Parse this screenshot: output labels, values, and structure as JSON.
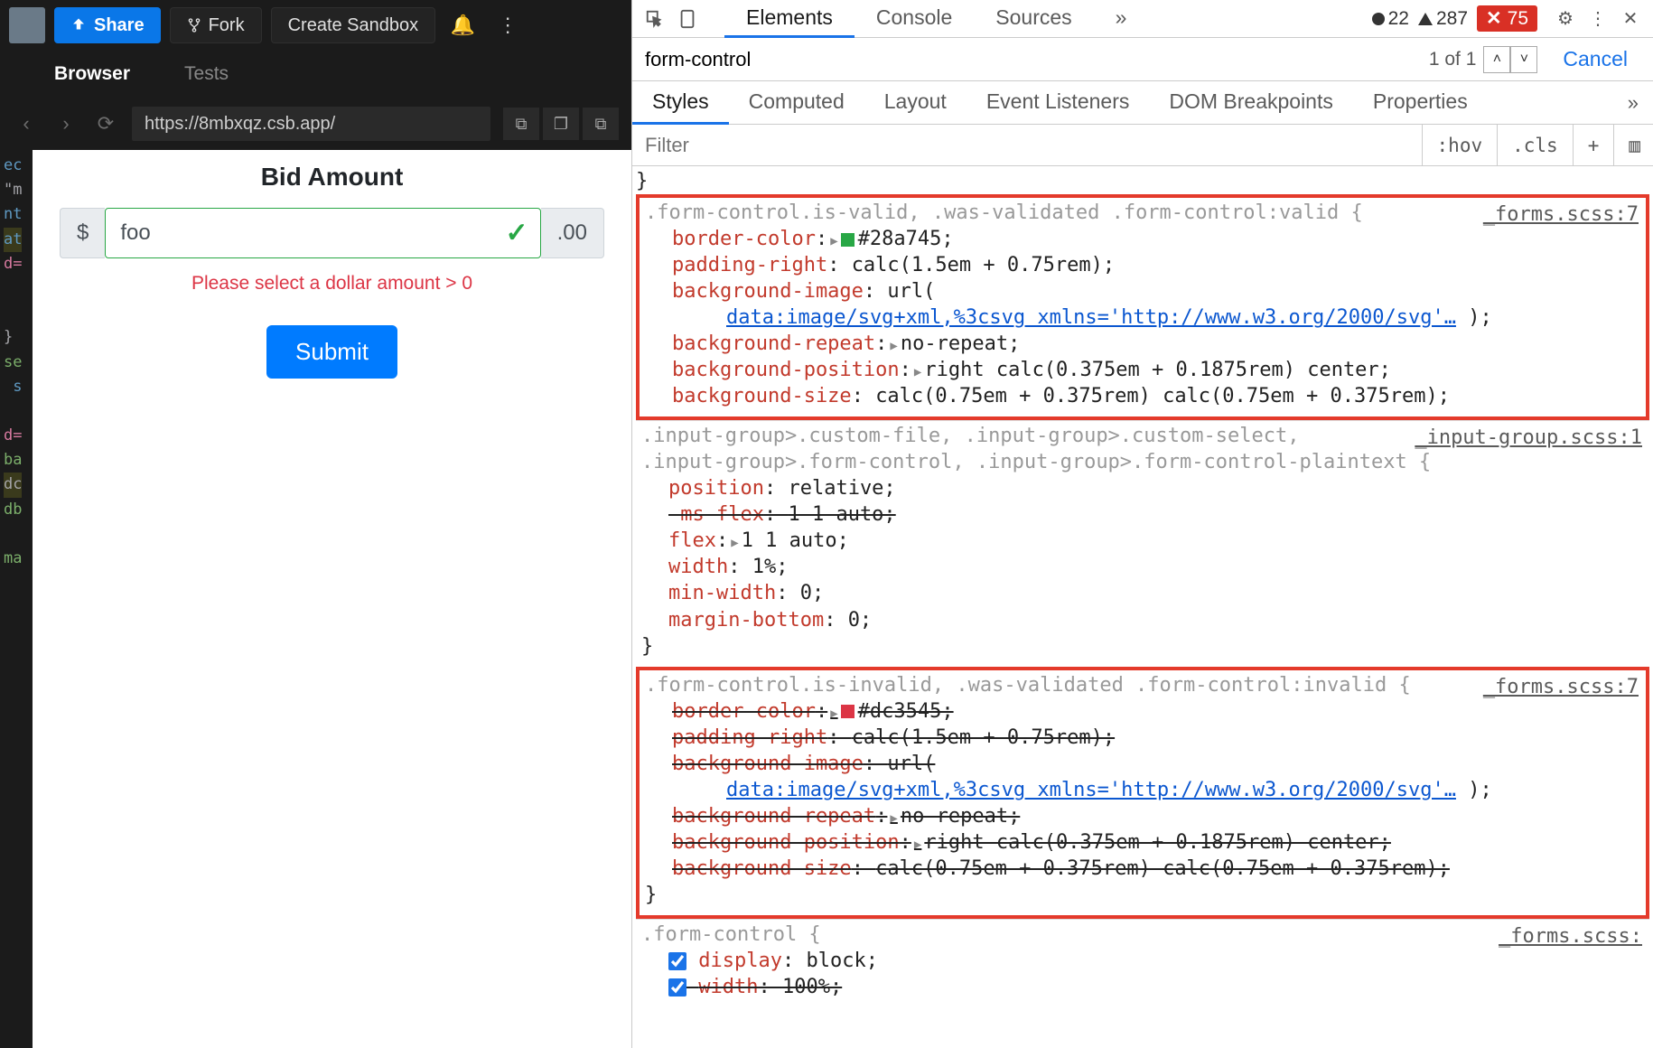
{
  "toolbar": {
    "share_label": "Share",
    "fork_label": "Fork",
    "create_sandbox_label": "Create Sandbox"
  },
  "tabs": {
    "browser": "Browser",
    "tests": "Tests"
  },
  "browser": {
    "url": "https://8mbxqz.csb.app/"
  },
  "gutter": {
    "l1": "ec",
    "l2": "\"m",
    "l3": "nt",
    "l4": "at",
    "l5": "d=",
    "l8": "}",
    "l9": "se",
    "l10": "s",
    "l12": "d=",
    "l13": "ba",
    "l14": "dc",
    "l15": "db",
    "l17": "ma"
  },
  "preview": {
    "title": "Bid Amount",
    "prefix": "$",
    "input_value": "foo",
    "suffix": ".00",
    "error": "Please select a dollar amount > 0",
    "submit": "Submit"
  },
  "devtools": {
    "tabs": {
      "elements": "Elements",
      "console": "Console",
      "sources": "Sources"
    },
    "status": {
      "log": "22",
      "warn": "287",
      "err": "75"
    },
    "search": {
      "query": "form-control",
      "result": "1 of 1",
      "cancel": "Cancel"
    },
    "subtabs": {
      "styles": "Styles",
      "computed": "Computed",
      "layout": "Layout",
      "listeners": "Event Listeners",
      "dom_bp": "DOM Breakpoints",
      "properties": "Properties"
    },
    "filter": {
      "placeholder": "Filter",
      "hov": ":hov",
      "cls": ".cls",
      "plus": "+"
    },
    "rules": {
      "r1": {
        "selector_gray": ".form-control.is-valid",
        "selector_rest": ", .was-validated .form-control:valid {",
        "source": "_forms.scss:7",
        "d1p": "border-color",
        "d1v": "#28a745;",
        "d2p": "padding-right",
        "d2v": "calc(1.5em + 0.75rem);",
        "d3p": "background-image",
        "d3v_a": "url(",
        "d3v_link": "data:image/svg+xml,%3csvg xmlns='http://www.w3.org/2000/svg'…",
        "d3v_b": " );",
        "d4p": "background-repeat",
        "d4v": "no-repeat;",
        "d5p": "background-position",
        "d5v": "right calc(0.375em + 0.1875rem) center;",
        "d6p": "background-size",
        "d6v": "calc(0.75em + 0.375rem) calc(0.75em + 0.375rem);"
      },
      "r2": {
        "sel_line1": ".input-group>.custom-file, .input-group>.custom-select,",
        "sel_line2_a": ".input-group>.form-control",
        "sel_line2_b": ", .input-group>.form-control-plaintext {",
        "source": "_input-group.scss:1",
        "d1p": "position",
        "d1v": "relative;",
        "d2p": "-ms-flex",
        "d2v": "1 1 auto;",
        "d3p": "flex",
        "d3v": "1 1 auto;",
        "d4p": "width",
        "d4v": "1%;",
        "d5p": "min-width",
        "d5v": "0;",
        "d6p": "margin-bottom",
        "d6v": "0;"
      },
      "r3": {
        "selector_active": ".form-control.is-invalid",
        "selector_rest": ", .was-validated .form-control:invalid {",
        "source": "_forms.scss:7",
        "d1p": "border-color",
        "d1v": "#dc3545;",
        "d2p": "padding-right",
        "d2v": "calc(1.5em + 0.75rem);",
        "d3p": "background-image",
        "d3v_a": "url(",
        "d3v_link": "data:image/svg+xml,%3csvg xmlns='http://www.w3.org/2000/svg'…",
        "d3v_b": " );",
        "d4p": "background-repeat",
        "d4v": "no-repeat;",
        "d5p": "background-position",
        "d5v": "right calc(0.375em + 0.1875rem) center;",
        "d6p": "background-size",
        "d6v": "calc(0.75em + 0.375rem) calc(0.75em + 0.375rem);"
      },
      "r4": {
        "selector": ".form-control {",
        "source": "_forms.scss:",
        "d1p": "display",
        "d1v": "block;",
        "d2p": "width",
        "d2v": "100%;"
      }
    }
  }
}
